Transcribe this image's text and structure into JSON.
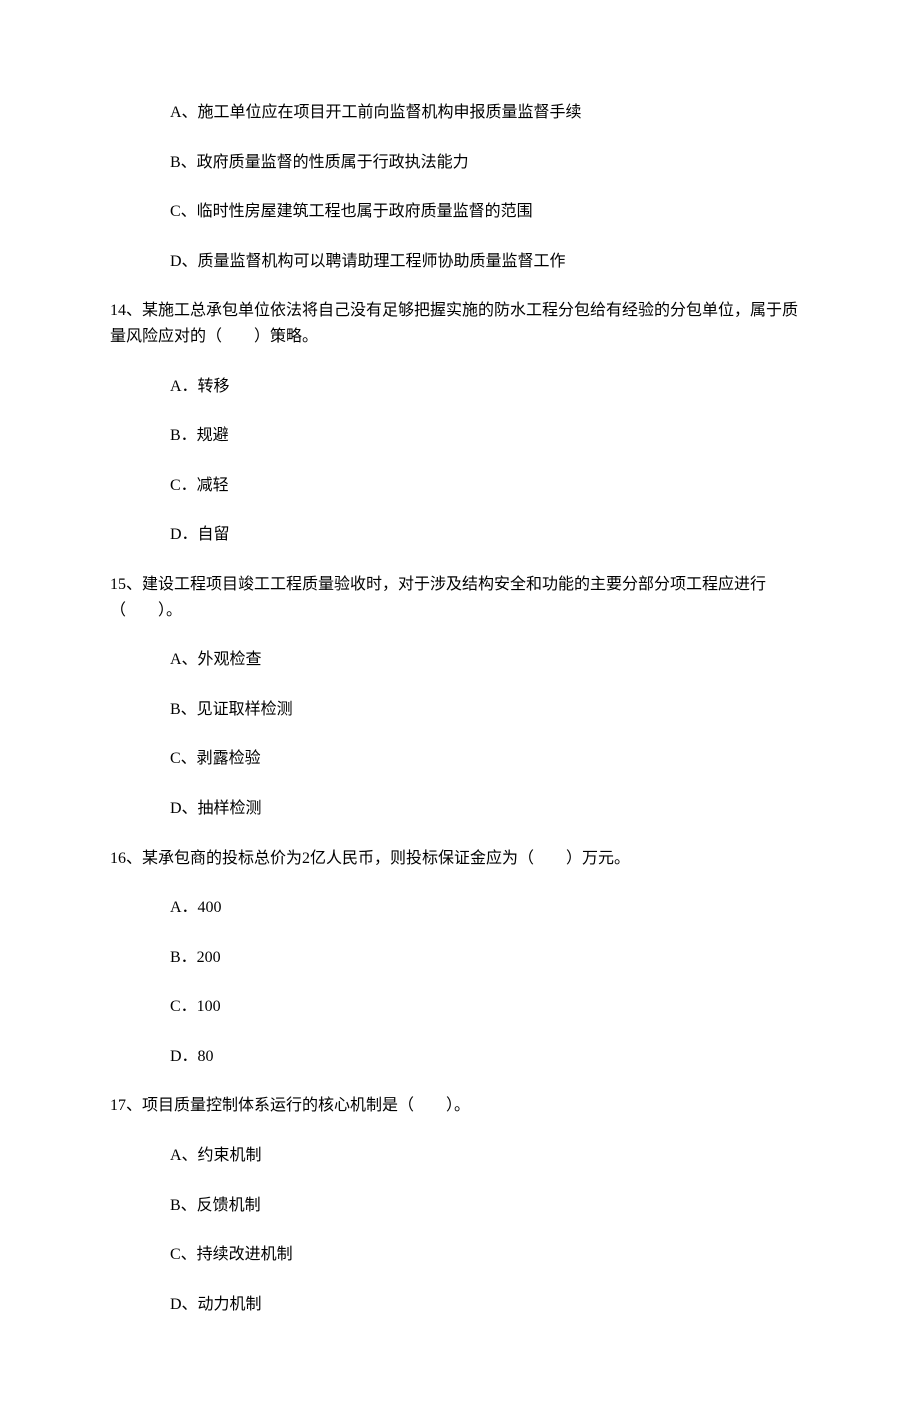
{
  "q13": {
    "options": {
      "A": "A、施工单位应在项目开工前向监督机构申报质量监督手续",
      "B": "B、政府质量监督的性质属于行政执法能力",
      "C": "C、临时性房屋建筑工程也属于政府质量监督的范围",
      "D": "D、质量监督机构可以聘请助理工程师协助质量监督工作"
    }
  },
  "q14": {
    "stem": "14、某施工总承包单位依法将自己没有足够把握实施的防水工程分包给有经验的分包单位，属于质量风险应对的（　　）策略。",
    "options": {
      "A": "A．转移",
      "B": "B．规避",
      "C": "C．减轻",
      "D": "D．自留"
    }
  },
  "q15": {
    "stem": "15、建设工程项目竣工工程质量验收时，对于涉及结构安全和功能的主要分部分项工程应进行（　　）。",
    "options": {
      "A": "A、外观检查",
      "B": "B、见证取样检测",
      "C": "C、剥露检验",
      "D": "D、抽样检测"
    }
  },
  "q16": {
    "stem": "16、某承包商的投标总价为2亿人民币，则投标保证金应为（　　）万元。",
    "options": {
      "A": "A．400",
      "B": "B．200",
      "C": "C．100",
      "D": "D．80"
    }
  },
  "q17": {
    "stem": "17、项目质量控制体系运行的核心机制是（　　）。",
    "options": {
      "A": "A、约束机制",
      "B": "B、反馈机制",
      "C": "C、持续改进机制",
      "D": "D、动力机制"
    }
  }
}
